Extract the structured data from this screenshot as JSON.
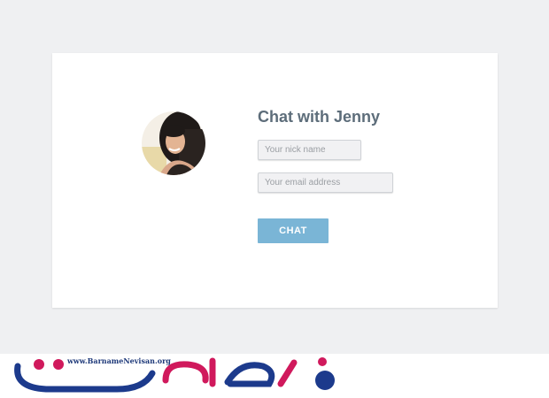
{
  "chat_form": {
    "title": "Chat with Jenny",
    "nick_placeholder": "Your nick name",
    "email_placeholder": "Your email address",
    "chat_button_label": "CHAT"
  },
  "avatar": {
    "icon": "avatar-photo"
  },
  "watermark": {
    "url_text": "www.BarnameNevisan.org",
    "logo_text": "برنامه نویسان",
    "colors": {
      "blue": "#1c3a8c",
      "magenta": "#d0195c"
    }
  },
  "colors": {
    "background": "#eff0f2",
    "card": "#ffffff",
    "title": "#5d6d7a",
    "button": "#7ab5d6"
  }
}
